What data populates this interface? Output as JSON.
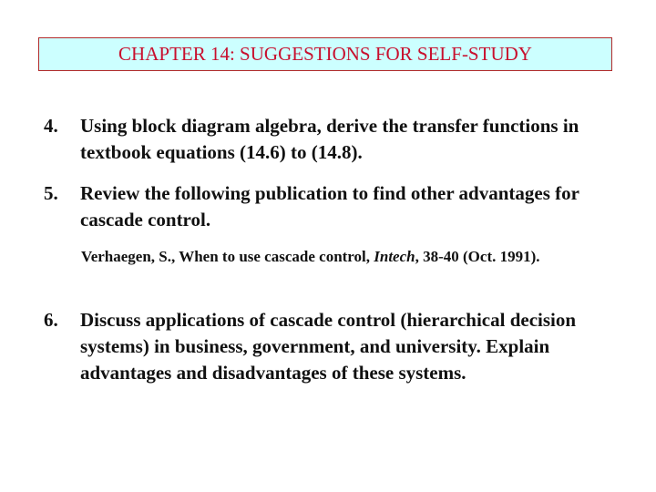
{
  "header": {
    "title": "CHAPTER 14: SUGGESTIONS FOR SELF-STUDY",
    "title_color": "#c8102e",
    "box_fill": "#ccffff",
    "box_border": "#b22a2a"
  },
  "items": [
    {
      "number": "4.",
      "text": "Using block diagram algebra, derive the transfer functions in textbook equations (14.6) to (14.8)."
    },
    {
      "number": "5.",
      "text": "Review the following publication to find other advantages for cascade control."
    },
    {
      "number": "6.",
      "text": "Discuss applications of cascade control (hierarchical decision systems) in business, government, and university.  Explain advantages and disadvantages of these systems."
    }
  ],
  "reference": {
    "before": "Verhaegen, S., When to use cascade control, ",
    "journal": "Intech",
    "after": ", 38-40 (Oct. 1991)."
  }
}
